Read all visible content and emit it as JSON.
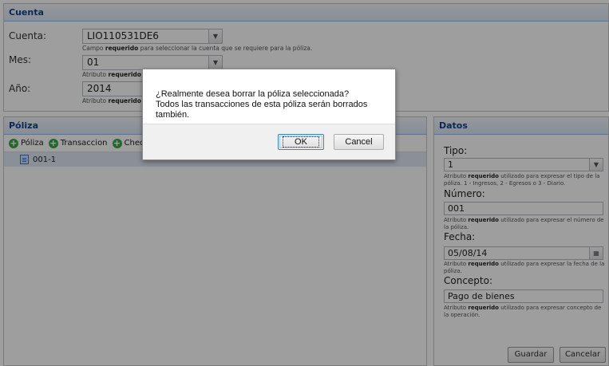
{
  "cuenta_panel": {
    "title": "Cuenta",
    "cuenta": {
      "label": "Cuenta:",
      "value": "LIO110531DE6",
      "hint_pre": "Campo ",
      "hint_bold": "requerido",
      "hint_post": " para seleccionar la cuenta que se requiere para la póliza."
    },
    "mes": {
      "label": "Mes:",
      "value": "01",
      "hint_pre": "Atributo ",
      "hint_bold": "requerido"
    },
    "anio": {
      "label": "Año:",
      "value": "2014",
      "hint_pre": "Atributo ",
      "hint_bold": "requerido"
    }
  },
  "poliza_panel": {
    "title": "Póliza",
    "toolbar": {
      "poliza": "Póliza",
      "transaccion": "Transaccion",
      "cheque": "Cheque"
    },
    "tree": [
      {
        "label": "001-1"
      }
    ]
  },
  "datos_panel": {
    "title": "Datos",
    "tipo": {
      "label": "Tipo:",
      "value": "1",
      "hint_pre": "Atributo ",
      "hint_bold": "requerido",
      "hint_post": " utilizado para expresar el tipo de la póliza. 1 - Ingresos, 2 - Egresos o 3 - Diario."
    },
    "numero": {
      "label": "Número:",
      "value": "001",
      "hint_pre": "Atributo ",
      "hint_bold": "requerido",
      "hint_post": " utilizado para expresar el número de la póliza."
    },
    "fecha": {
      "label": "Fecha:",
      "value": "05/08/14",
      "hint_pre": "Atributo ",
      "hint_bold": "requerido",
      "hint_post": " utilizado para expresar la fecha de la póliza."
    },
    "concepto": {
      "label": "Concepto:",
      "value": "Pago de bienes",
      "hint_pre": "Atributo ",
      "hint_bold": "requerido",
      "hint_post": " utilizado para expresar concepto de la operación."
    },
    "buttons": {
      "guardar": "Guardar",
      "cancelar": "Cancelar"
    }
  },
  "dialog": {
    "line1": "¿Realmente desea borrar la póliza seleccionada?",
    "line2": "Todos las transacciones de esta póliza serán borrados también.",
    "ok": "OK",
    "cancel": "Cancel"
  },
  "colors": {
    "header_text": "#15428b",
    "overlay": "rgba(0,0,0,0.38)",
    "add_icon": "#3aa84a"
  }
}
